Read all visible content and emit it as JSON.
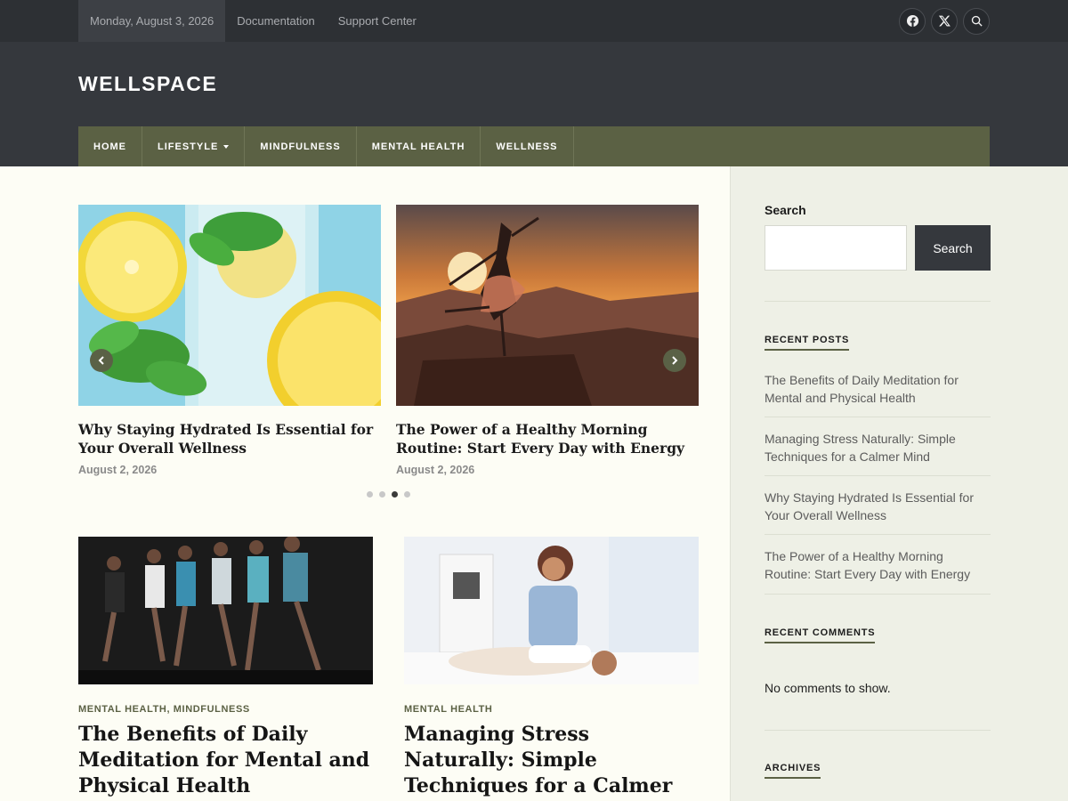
{
  "topbar": {
    "date": "Monday, August 3, 2026",
    "links": [
      "Documentation",
      "Support Center"
    ],
    "icons": [
      "facebook-icon",
      "x-icon",
      "search-icon"
    ]
  },
  "site": {
    "title": "WELLSPACE"
  },
  "nav": {
    "items": [
      "HOME",
      "LIFESTYLE",
      "MINDFULNESS",
      "MENTAL HEALTH",
      "WELLNESS"
    ]
  },
  "slider": {
    "slides": [
      {
        "title": "Why Staying Hydrated Is Essential for Your Overall Wellness",
        "date": "August 2, 2026"
      },
      {
        "title": "The Power of a Healthy Morning Routine: Start Every Day with Energy",
        "date": "August 2, 2026"
      }
    ],
    "dot_count": 4,
    "active_dot": 3
  },
  "posts": [
    {
      "category": "MENTAL HEALTH, MINDFULNESS",
      "title": "The Benefits of Daily Meditation for Mental and Physical Health"
    },
    {
      "category": "MENTAL HEALTH",
      "title": "Managing Stress Naturally: Simple Techniques for a Calmer Mind"
    }
  ],
  "sidebar": {
    "search_label": "Search",
    "search_button": "Search",
    "recent_posts_heading": "RECENT POSTS",
    "recent_posts": [
      "The Benefits of Daily Meditation for Mental and Physical Health",
      "Managing Stress Naturally: Simple Techniques for a Calmer Mind",
      "Why Staying Hydrated Is Essential for Your Overall Wellness",
      "The Power of a Healthy Morning Routine: Start Every Day with Energy"
    ],
    "recent_comments_heading": "RECENT COMMENTS",
    "no_comments": "No comments to show.",
    "archives_heading": "ARCHIVES"
  },
  "colors": {
    "topbar": "#2d3034",
    "header": "#35383d",
    "nav": "#5b6144",
    "accent": "#5b6144",
    "page": "#fdfdf5",
    "sidebar": "#eef0e6"
  }
}
